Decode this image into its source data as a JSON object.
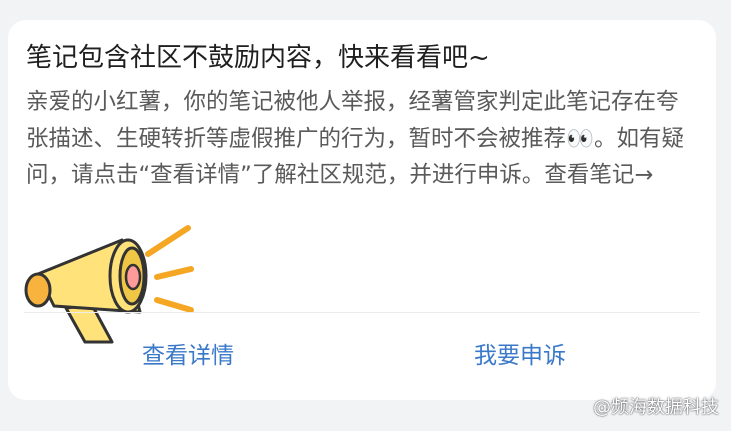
{
  "notification": {
    "title": "笔记包含社区不鼓励内容，快来看看吧~",
    "body": "亲爱的小红薯，你的笔记被他人举报，经薯管家判定此笔记存在夸张描述、生硬转折等虚假推广的行为，暂时不会被推荐👀。如有疑问，请点击“查看详情”了解社区规范，并进行申诉。",
    "view_note_link": "查看笔记→",
    "actions": {
      "details_label": "查看详情",
      "appeal_label": "我要申诉"
    }
  },
  "watermark": "@频海数据科技",
  "colors": {
    "link_blue": "#3a78c9",
    "megaphone_yellow": "#ffe27a",
    "megaphone_orange": "#f5a623"
  },
  "icons": {
    "megaphone": "megaphone-icon",
    "watermark_logo": "headset-icon"
  }
}
